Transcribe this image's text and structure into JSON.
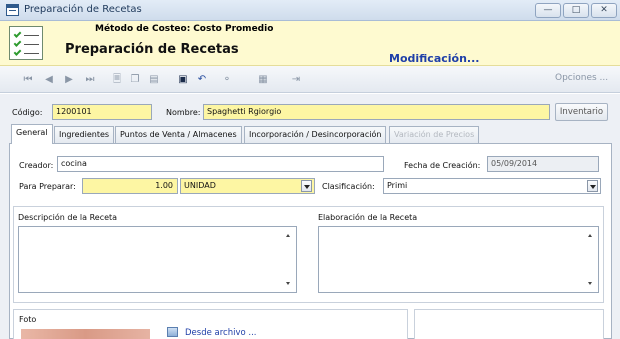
{
  "window": {
    "title": "Preparación de Recetas",
    "controls": [
      "minimize",
      "maximize",
      "close"
    ]
  },
  "header": {
    "costeo_label": "Método de Costeo:",
    "costeo_value": "Costo Promedio",
    "title": "Preparación de Recetas",
    "mode": "Modificación..."
  },
  "toolbar": {
    "icons": [
      "first-icon",
      "prev-icon",
      "next-icon",
      "last-icon",
      "new-icon",
      "copy-icon",
      "print-icon",
      "save-icon",
      "undo-icon",
      "search-icon",
      "calendar-icon",
      "export-icon"
    ],
    "options_label": "Opciones ..."
  },
  "record": {
    "codigo_label": "Código:",
    "codigo_value": "1200101",
    "nombre_label": "Nombre:",
    "nombre_value": "Spaghetti Rgiorgio",
    "inventario_button": "Inventario"
  },
  "tabs": [
    {
      "label": "General",
      "active": true
    },
    {
      "label": "Ingredientes"
    },
    {
      "label": "Puntos de Venta / Almacenes"
    },
    {
      "label": "Incorporación / Desincorporación"
    },
    {
      "label": "Variación de Precios",
      "disabled": true
    }
  ],
  "general": {
    "creador_label": "Creador:",
    "creador_value": "cocina",
    "fecha_label": "Fecha de Creación:",
    "fecha_value": "05/09/2014",
    "preparar_label": "Para Preparar:",
    "preparar_value": "1.00",
    "unidad_value": "UNIDAD",
    "clasificacion_label": "Clasificación:",
    "clasificacion_value": "Primi",
    "descripcion_label": "Descripción de la Receta",
    "elaboracion_label": "Elaboración de la Receta",
    "foto_label": "Foto",
    "desde_archivo": "Desde archivo ..."
  },
  "colors": {
    "header_bg": "#fefad0",
    "field_yellow": "#fdf6a3",
    "mode_blue": "#1f3fa8"
  }
}
